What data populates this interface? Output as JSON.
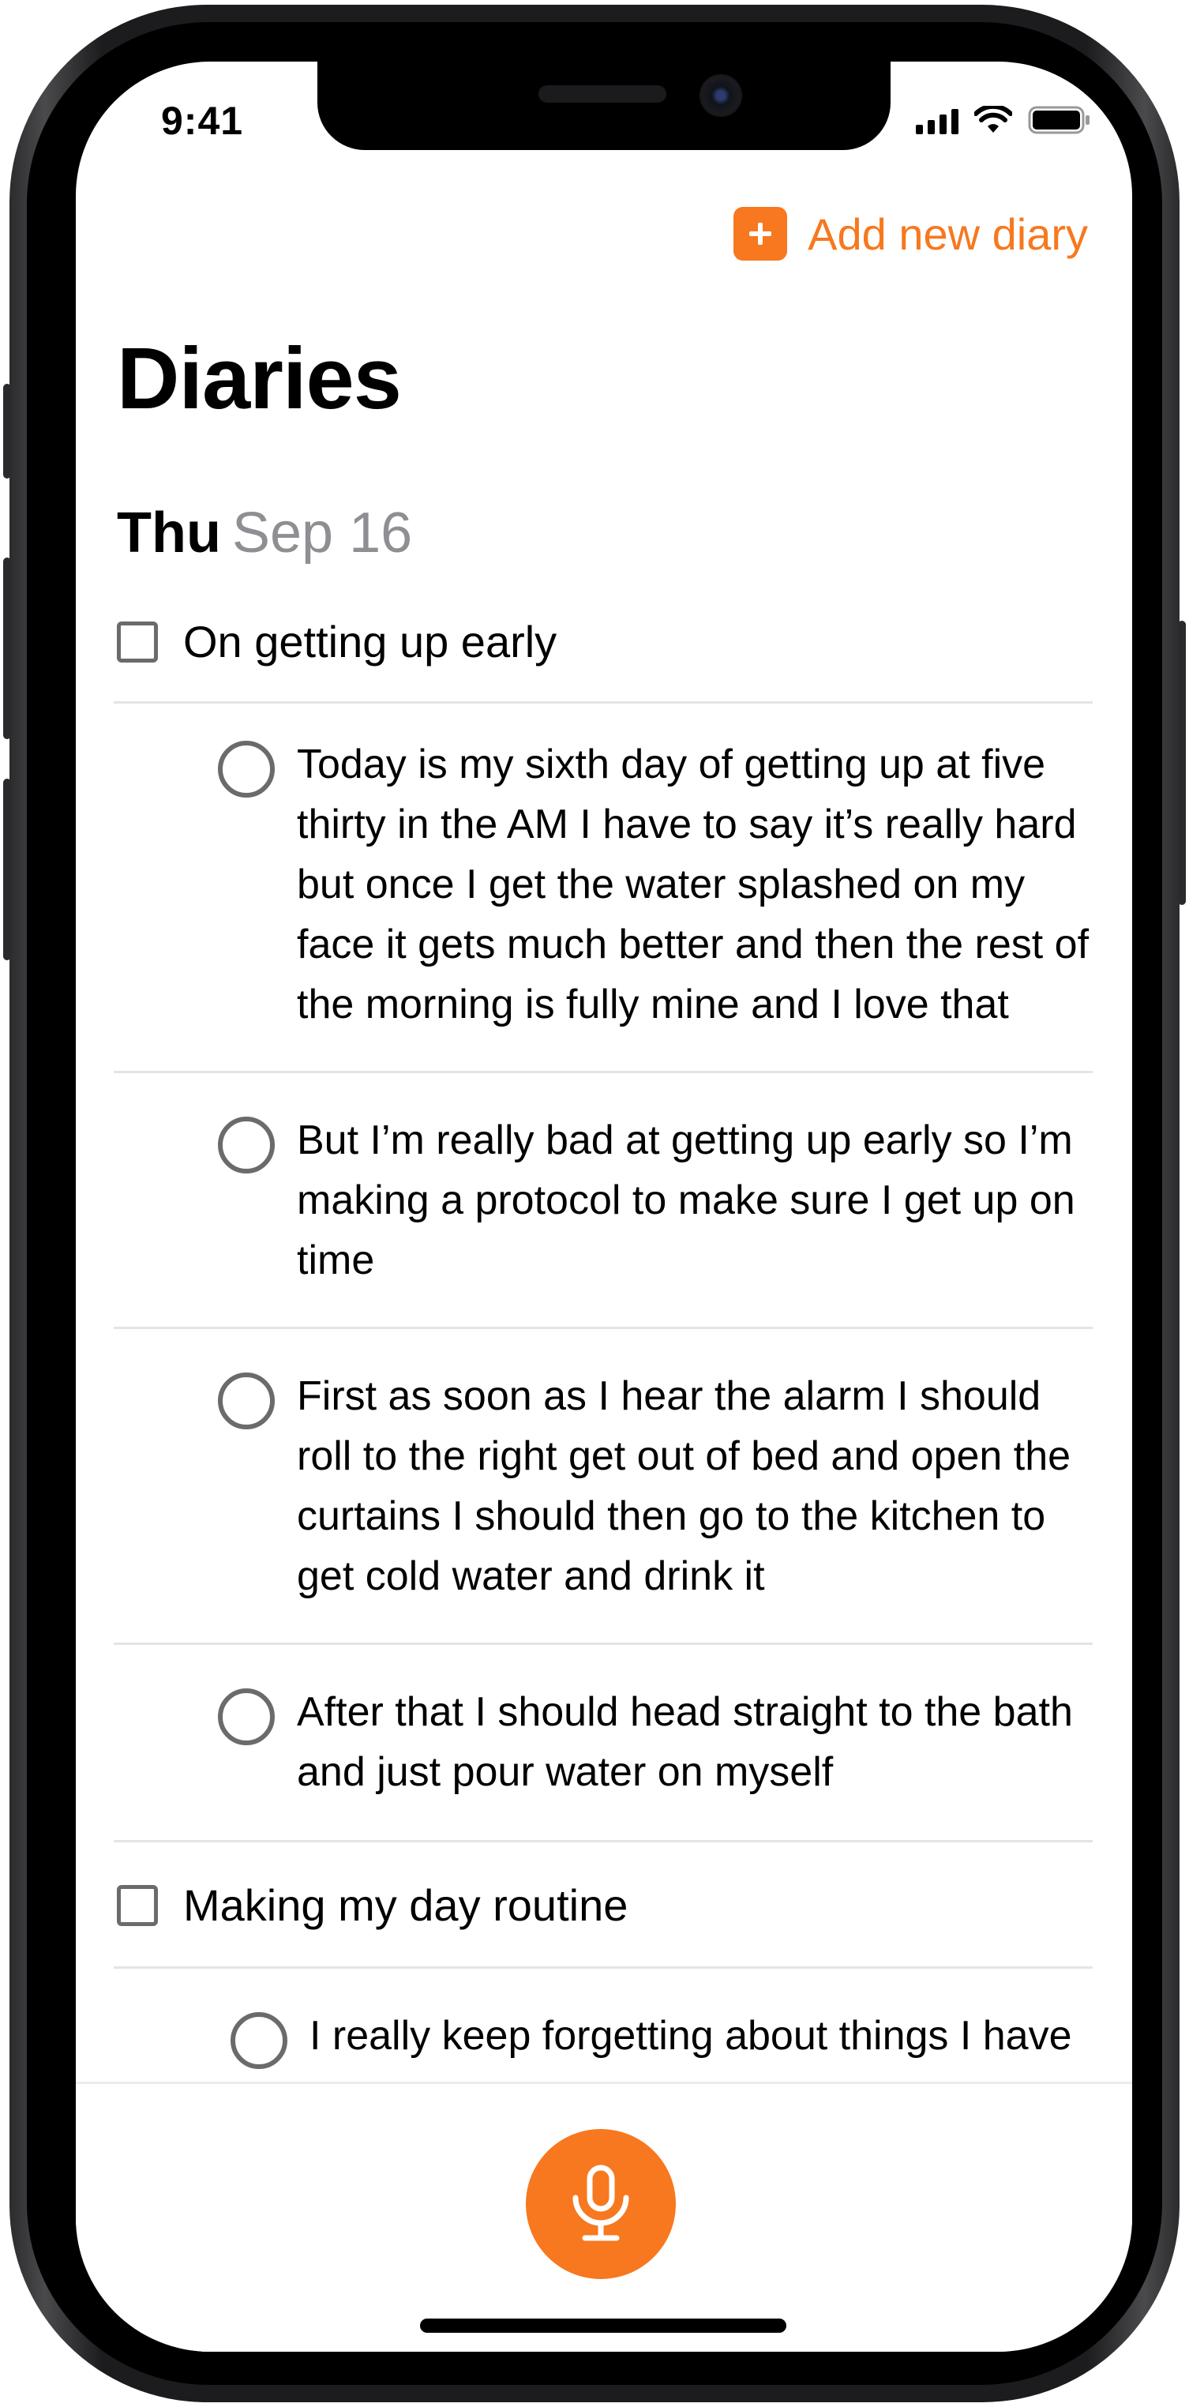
{
  "status_bar": {
    "time": "9:41",
    "icons": [
      "cellular-signal-icon",
      "wifi-icon",
      "battery-icon"
    ]
  },
  "header": {
    "add_button_label": "Add new diary",
    "add_icon": "plus-icon"
  },
  "page_title": "Diaries",
  "date": {
    "weekday": "Thu",
    "month_day": "Sep 16"
  },
  "diaries": [
    {
      "title": "On getting up early",
      "entries": [
        {
          "text": "Today is my sixth day of getting up at five thirty in the AM I have to say it’s really hard but once I get the water splashed on my face it gets much better and then the rest of the morning is fully mine and I love that"
        },
        {
          "text": "But I’m really bad at getting up early so I’m making a protocol to make sure I get up on time"
        },
        {
          "text": "First as soon as I hear the alarm I should roll to the right get out of bed and open the curtains I should then go to the kitchen to get cold water and drink it"
        },
        {
          "text": "After that I should head straight to the bath and just pour water on myself"
        }
      ]
    },
    {
      "title": "Making my day routine",
      "entries": [
        {
          "text": "I really keep forgetting about things I have"
        }
      ]
    }
  ],
  "bottom": {
    "mic_icon": "microphone-icon"
  },
  "colors": {
    "accent": "#f7781f",
    "secondary_text": "#8e8e93",
    "divider": "#e4e4e6"
  }
}
